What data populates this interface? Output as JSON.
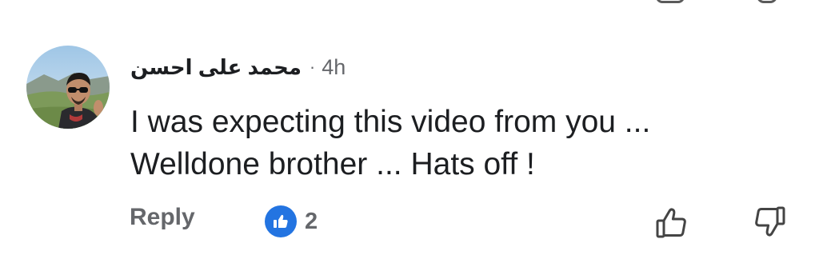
{
  "comment": {
    "author": "محمد على احسن",
    "separator": "·",
    "time": "4h",
    "body_lines": [
      "I was expecting this video from you ...",
      "Welldone brother ... Hats off !"
    ]
  },
  "actions": {
    "reply_label": "Reply",
    "reaction_count": "2"
  },
  "icons": {
    "reaction_badge": "thumbs-up-icon",
    "like_button": "thumbs-up-outline-icon",
    "dislike_button": "thumbs-down-outline-icon"
  },
  "colors": {
    "reaction_badge": "#2374e1",
    "secondary_text": "#65676b",
    "primary_text": "#1c1e21"
  }
}
